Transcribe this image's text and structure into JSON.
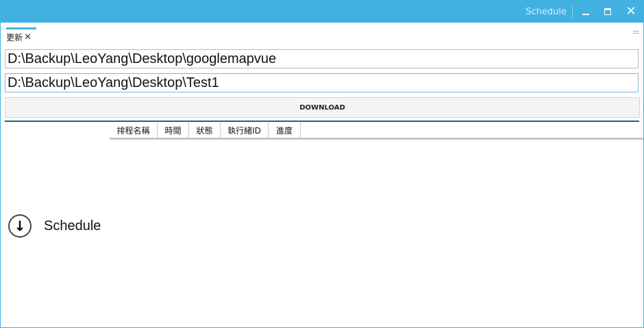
{
  "window": {
    "title": "Schedule",
    "min_glyph": "",
    "close_glyph": "✕"
  },
  "tab": {
    "label": "更新",
    "close_glyph": "✕"
  },
  "source_path": "D:\\Backup\\LeoYang\\Desktop\\googlemapvue",
  "target_path": "D:\\Backup\\LeoYang\\Desktop\\Test1",
  "download_button": "DOWNLOAD",
  "table": {
    "columns": [
      "排程名稱",
      "時間",
      "狀態",
      "執行緒ID",
      "進度"
    ]
  },
  "nav": {
    "label": "Schedule",
    "icon_glyph": "↓",
    "icon": "arrow-down-circle-icon"
  },
  "colors": {
    "accent": "#41b1e1",
    "progress": "#1e5f8a"
  }
}
